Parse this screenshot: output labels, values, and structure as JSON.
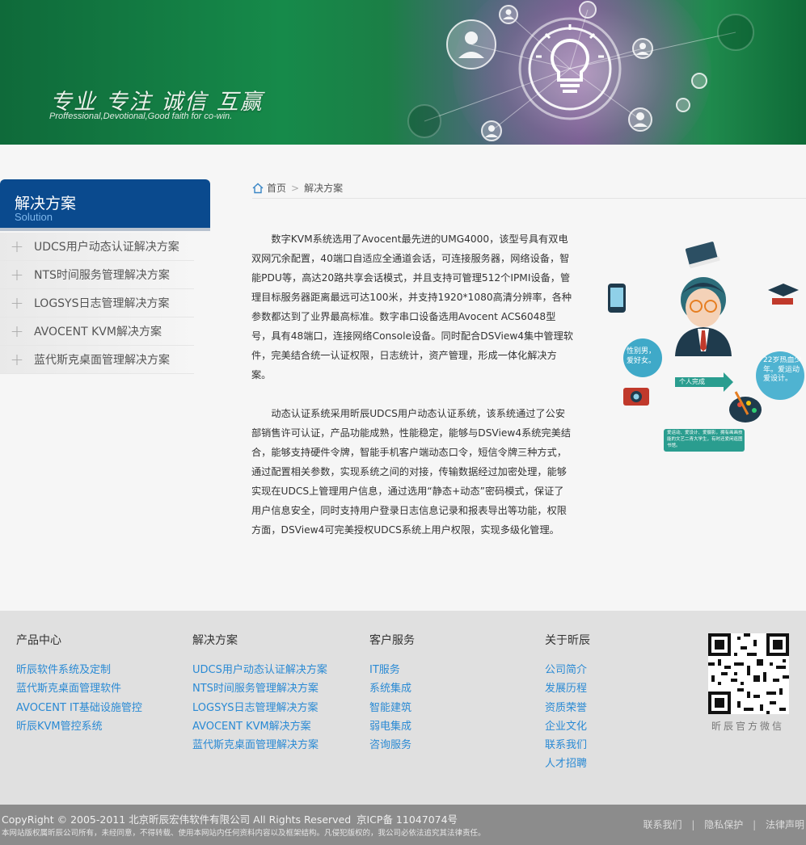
{
  "banner": {
    "slogan": "专业  专注  诚信  互赢",
    "subtitle": "Proffessional,Devotional,Good faith for co-win."
  },
  "sidebar": {
    "title": "解决方案",
    "subtitle": "Solution",
    "items": [
      {
        "label": "UDCS用户动态认证解决方案"
      },
      {
        "label": "NTS时间服务管理解决方案"
      },
      {
        "label": "LOGSYS日志管理解决方案"
      },
      {
        "label": "AVOCENT KVM解决方案"
      },
      {
        "label": "蓝代斯克桌面管理解决方案"
      }
    ]
  },
  "breadcrumb": {
    "home": "首页",
    "separator": ">",
    "current": "解决方案"
  },
  "content": {
    "paragraphs": [
      "数字KVM系统选用了Avocent最先进的UMG4000，该型号具有双电双网冗余配置，40端口自适应全通道会话，可连接服务器，网络设备，智能PDU等，高达20路共享会话模式，并且支持可管理512个IPMI设备，管理目标服务器距离最远可达100米，并支持1920*1080高清分辨率，各种参数都达到了业界最高标准。数字串口设备选用Avocent ACS6048型号，具有48端口，连接网络Console设备。同时配合DSView4集中管理软件，完美结合统一认证权限，日志统计，资产管理，形成一体化解决方案。",
      "动态认证系统采用昕辰UDCS用户动态认证系统，该系统通过了公安部销售许可认证，产品功能成熟，性能稳定，能够与DSView4系统完美结合，能够支持硬件令牌，智能手机客户端动态口令，短信令牌三种方式，通过配置相关参数，实现系统之间的对接，传输数据经过加密处理，能够实现在UDCS上管理用户信息，通过选用“静态+动态”密码模式，保证了用户信息安全，同时支持用户登录日志信息记录和报表导出等功能，权限方面，DSView4可完美授权UDCS系统上用户权限，实现多级化管理。"
    ]
  },
  "illustration": {
    "bubble_left": "性别男，爱好女。",
    "bubble_right": "22岁热血少年。爱运动爱设计。",
    "arrow_label": "个人完成",
    "bottom_note": "爱运动、爱设计、爱摄影，拥有画画技能的文艺二青大学生，有时还爱闲逛图书馆。"
  },
  "footer": {
    "columns": [
      {
        "heading": "产品中心",
        "links": [
          "昕辰软件系统及定制",
          "蓝代斯克桌面管理软件",
          "AVOCENT IT基础设施管控",
          "昕辰KVM管控系统"
        ]
      },
      {
        "heading": "解决方案",
        "links": [
          "UDCS用户动态认证解决方案",
          "NTS时间服务管理解决方案",
          "LOGSYS日志管理解决方案",
          "AVOCENT KVM解决方案",
          "蓝代斯克桌面管理解决方案"
        ]
      },
      {
        "heading": "客户服务",
        "links": [
          "IT服务",
          "系统集成",
          "智能建筑",
          "弱电集成",
          "咨询服务"
        ]
      },
      {
        "heading": "关于昕辰",
        "links": [
          "公司简介",
          "发展历程",
          "资质荣誉",
          "企业文化",
          "联系我们",
          "人才招聘"
        ]
      }
    ],
    "qr_caption": "昕辰官方微信"
  },
  "bottom": {
    "copyright": "CopyRight © 2005-2011 北京昕辰宏伟软件有限公司 All Rights Reserved",
    "icp": "京ICP备 11047074号",
    "notice": "本网站版权属昕辰公司所有，未经同意，不得转载、使用本网站内任何资料内容以及框架结构。凡侵犯版权的，我公司必依法追究其法律责任。",
    "links": [
      "联系我们",
      "隐私保护",
      "法律声明"
    ],
    "separator": "|"
  },
  "colors": {
    "banner_green": "#168a4a",
    "sidebar_blue": "#0a4a8e",
    "link_blue": "#2a8ad4",
    "footer_bg": "#e0e0e0",
    "bottom_bg": "#8c8c8c"
  }
}
